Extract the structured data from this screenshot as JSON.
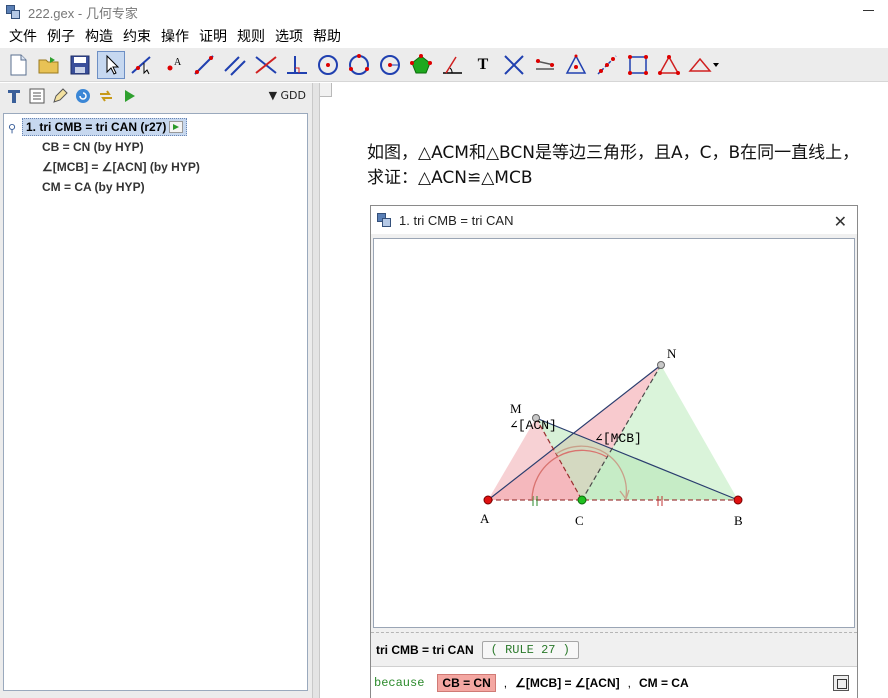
{
  "window": {
    "title": "222.gex - 几何专家"
  },
  "menu": {
    "items": [
      "文件",
      "例子",
      "构造",
      "约束",
      "操作",
      "证明",
      "规则",
      "选项",
      "帮助"
    ]
  },
  "toolbar": {
    "buttons": [
      "new-file-icon",
      "open-folder-icon",
      "save-icon",
      "select-arrow-icon",
      "point-on-line-icon",
      "point-icon",
      "line-icon",
      "parallel-line-icon",
      "perpendicular-cross-icon",
      "perpendicular-foot-icon",
      "circle-icon",
      "circle-three-point-icon",
      "circle-center-icon",
      "polygon-icon",
      "angle-icon",
      "text-icon",
      "intersection-icon",
      "mirror-icon",
      "triangle-center-icon",
      "midpoint-icon",
      "square-icon",
      "triangle-icon",
      "isosceles-dropdown-icon"
    ],
    "text_label": "T"
  },
  "left_panel": {
    "gdd_label": "GDD",
    "tree": {
      "root": "1. tri CMB = tri CAN  (r27)",
      "children": [
        "CB = CN   (by HYP)",
        "∠[MCB] = ∠[ACN]   (by HYP)",
        "CM = CA   (by HYP)"
      ]
    }
  },
  "problem": {
    "line1": "如图，△ACM和△BCN是等边三角形，且A，C，B在同一直线上，",
    "line2": "求证：△ACN≌△MCB"
  },
  "dialog": {
    "title": "1. tri CMB = tri CAN",
    "statement": "tri CMB = tri CAN",
    "rule": "( RULE 27 )",
    "because_label": "because",
    "conditions": [
      "CB = CN",
      "∠[MCB] = ∠[ACN]",
      "CM = CA"
    ],
    "separator": ","
  },
  "figure": {
    "points": {
      "A": "A",
      "C": "C",
      "B": "B",
      "M": "M",
      "N": "N"
    },
    "angle_labels": {
      "acn": "∠[ACN]",
      "mcb": "∠[MCB]"
    }
  }
}
